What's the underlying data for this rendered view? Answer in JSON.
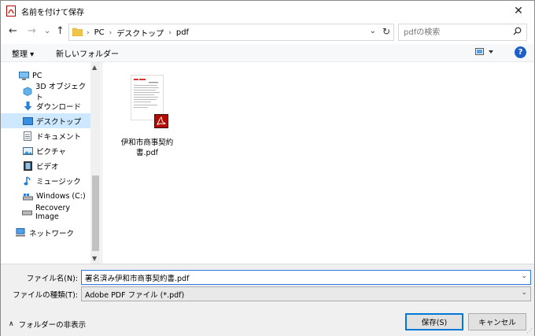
{
  "window": {
    "title": "名前を付けて保存",
    "close": "✕"
  },
  "nav": {
    "back": "←",
    "forward": "→",
    "recent": "⌄",
    "up": "↑",
    "breadcrumbs": [
      "PC",
      "デスクトップ",
      "pdf"
    ],
    "refresh": "↻",
    "dropdown": "⌄",
    "search_placeholder": "pdfの検索"
  },
  "toolbar": {
    "organize": "整理 ▾",
    "new_folder": "新しいフォルダー",
    "help": "?"
  },
  "sidebar": {
    "items": [
      {
        "label": "PC",
        "icon": "pc-icon"
      },
      {
        "label": "3D オブジェクト",
        "icon": "3d-objects-icon"
      },
      {
        "label": "ダウンロード",
        "icon": "download-icon"
      },
      {
        "label": "デスクトップ",
        "icon": "desktop-icon",
        "selected": true
      },
      {
        "label": "ドキュメント",
        "icon": "documents-icon"
      },
      {
        "label": "ピクチャ",
        "icon": "pictures-icon"
      },
      {
        "label": "ビデオ",
        "icon": "video-icon"
      },
      {
        "label": "ミュージック",
        "icon": "music-icon"
      },
      {
        "label": "Windows (C:)",
        "icon": "drive-icon"
      },
      {
        "label": "Recovery Image",
        "icon": "drive-icon"
      },
      {
        "label": "ネットワーク",
        "icon": "network-icon"
      }
    ]
  },
  "files": [
    {
      "name": "伊和市商事契約書.pdf",
      "icon": "pdf-icon"
    }
  ],
  "form": {
    "filename_label": "ファイル名(N):",
    "filename_value": "署名済み伊和市商事契約書.pdf",
    "filetype_label": "ファイルの種類(T):",
    "filetype_value": "Adobe PDF ファイル (*.pdf)",
    "hide_folders": "フォルダーの非表示",
    "save": "保存(S)",
    "cancel": "キャンセル"
  },
  "colors": {
    "accent": "#0078d7",
    "selection": "#cde8ff",
    "help": "#1e5fc7"
  }
}
